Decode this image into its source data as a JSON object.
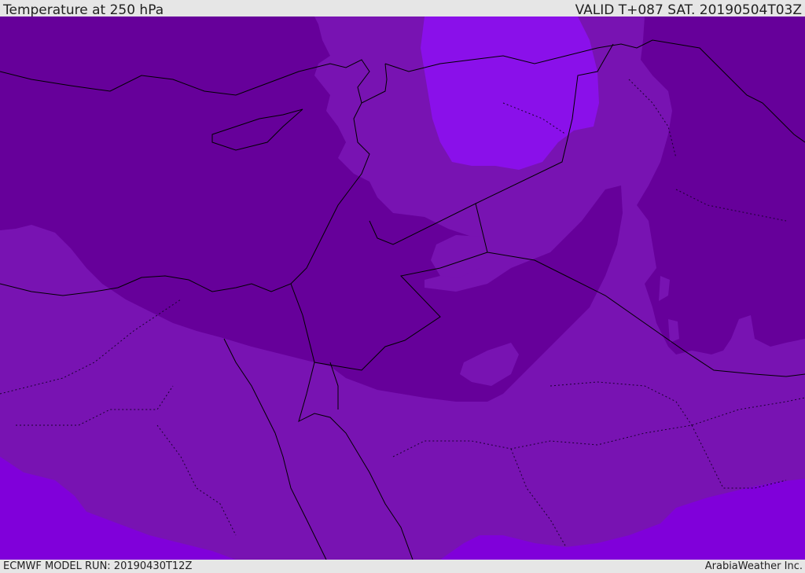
{
  "header": {
    "title": "Temperature at 250 hPa",
    "valid": "VALID T+087 SAT. 20190504T03Z"
  },
  "footer": {
    "model_run": "ECMWF MODEL RUN: 20190430T12Z",
    "credit": "ArabiaWeather Inc."
  },
  "map": {
    "colors": {
      "cold": "#66009a",
      "mid": "#7813b2",
      "warm": "#8000da",
      "warmest": "#8a10ea",
      "border": "#000000"
    }
  }
}
